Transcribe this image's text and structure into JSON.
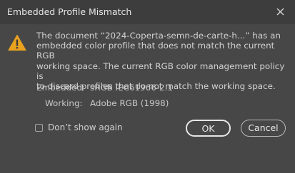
{
  "window": {
    "title": "Embedded Profile Mismatch",
    "close_icon": "close-icon"
  },
  "message": {
    "icon": "warning-icon",
    "line1": "The document “2024-Coperta-semn-de-carte-h...” has an",
    "line2": "embedded color profile that does not match the current RGB",
    "line3": "working space.  The current RGB color management policy is",
    "line4": "to discard profiles that do not match the working space."
  },
  "profiles": {
    "embedded_label": "Embedded:",
    "embedded_value": "sRGB IEC61966-2.1",
    "working_label": "Working:",
    "working_value": "Adobe RGB (1998)"
  },
  "options": {
    "dont_show_label": "Don’t show again",
    "dont_show_checked": false
  },
  "buttons": {
    "ok_label": "OK",
    "cancel_label": "Cancel"
  },
  "colors": {
    "warning": "#e8a21f",
    "background": "#474747",
    "titlebar": "#3d3d3d"
  }
}
